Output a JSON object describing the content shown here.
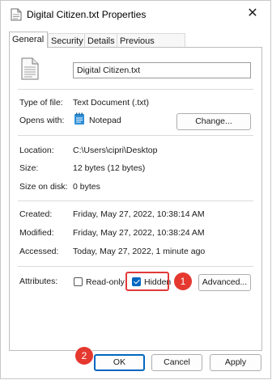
{
  "window": {
    "title": "Digital Citizen.txt Properties",
    "close_glyph": "✕"
  },
  "tabs": [
    {
      "label": "General",
      "active": true
    },
    {
      "label": "Security",
      "active": false
    },
    {
      "label": "Details",
      "active": false
    },
    {
      "label": "Previous Versions",
      "active": false
    }
  ],
  "general": {
    "file_name": "Digital Citizen.txt",
    "file_icon": "text-document-icon",
    "type_label": "Type of file:",
    "type_value": "Text Document (.txt)",
    "opens_label": "Opens with:",
    "opens_value": "Notepad",
    "opens_icon": "notepad-icon",
    "change_button": "Change...",
    "location_label": "Location:",
    "location_value": "C:\\Users\\cipri\\Desktop",
    "size_label": "Size:",
    "size_value": "12 bytes (12 bytes)",
    "size_on_disk_label": "Size on disk:",
    "size_on_disk_value": "0 bytes",
    "created_label": "Created:",
    "created_value": "Friday, May 27, 2022, 10:38:14 AM",
    "modified_label": "Modified:",
    "modified_value": "Friday, May 27, 2022, 10:38:24 AM",
    "accessed_label": "Accessed:",
    "accessed_value": "Today, May 27, 2022, 1 minute ago",
    "attributes_label": "Attributes:",
    "readonly_label": "Read-only",
    "readonly_checked": false,
    "hidden_label": "Hidden",
    "hidden_checked": true,
    "advanced_button": "Advanced..."
  },
  "footer": {
    "ok_button": "OK",
    "cancel_button": "Cancel",
    "apply_button": "Apply"
  },
  "annotations": {
    "step1": "1",
    "step2": "2",
    "highlight_color": "#e03a3a",
    "badge_color": "#e5382f"
  },
  "colors": {
    "accent": "#0067c0"
  }
}
